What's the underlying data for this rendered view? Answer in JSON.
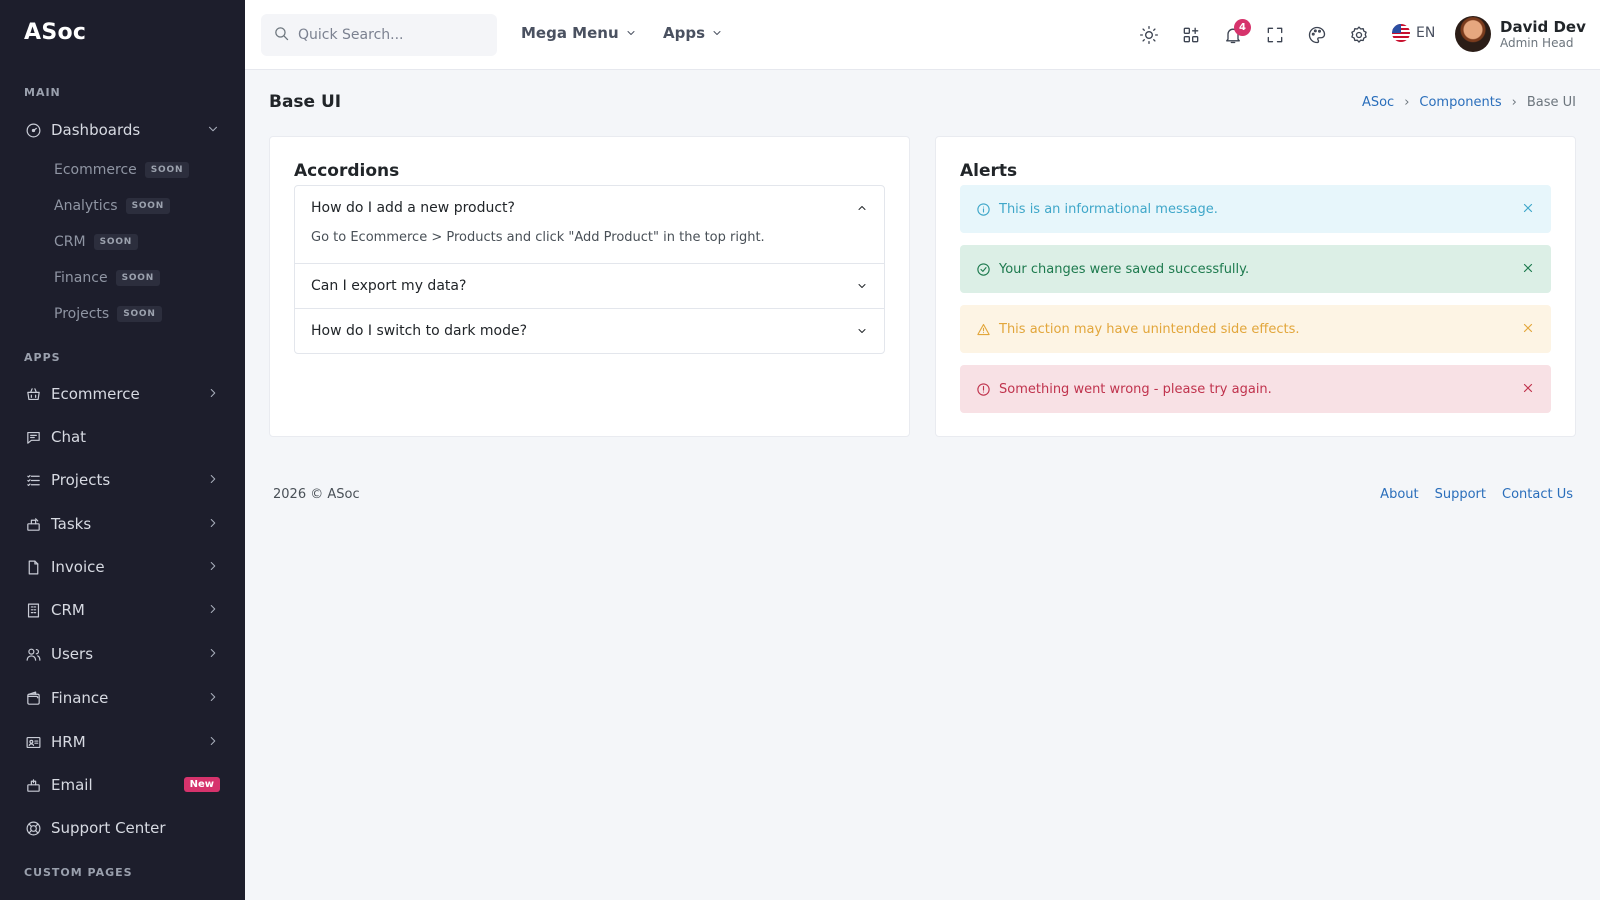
{
  "app": {
    "brand": "ASoc"
  },
  "sidebar": {
    "sections": {
      "main": "MAIN",
      "apps": "APPS",
      "custom": "CUSTOM PAGES"
    },
    "dashboards": {
      "label": "Dashboards",
      "soon": "SOON",
      "children": [
        "Ecommerce",
        "Analytics",
        "CRM",
        "Finance",
        "Projects"
      ]
    },
    "items": [
      {
        "label": "Ecommerce",
        "icon": "basket-icon"
      },
      {
        "label": "Chat",
        "icon": "chat-icon"
      },
      {
        "label": "Projects",
        "icon": "list-icon"
      },
      {
        "label": "Tasks",
        "icon": "tasks-icon"
      },
      {
        "label": "Invoice",
        "icon": "file-icon"
      },
      {
        "label": "CRM",
        "icon": "building-icon"
      },
      {
        "label": "Users",
        "icon": "users-icon"
      },
      {
        "label": "Finance",
        "icon": "wallet-icon"
      },
      {
        "label": "HRM",
        "icon": "id-card-icon"
      },
      {
        "label": "Email",
        "icon": "mailbox-icon",
        "badge": "New"
      },
      {
        "label": "Support Center",
        "icon": "lifebuoy-icon"
      }
    ]
  },
  "header": {
    "search_placeholder": "Quick Search...",
    "mega_menu": "Mega Menu",
    "apps": "Apps",
    "notifications_count": "4",
    "language": "EN",
    "user": {
      "name": "David Dev",
      "role": "Admin Head"
    }
  },
  "page": {
    "title": "Base UI",
    "breadcrumb": [
      "ASoc",
      "Components",
      "Base UI"
    ]
  },
  "accordions": {
    "title": "Accordions",
    "items": [
      {
        "question": "How do I add a new product?",
        "answer": "Go to Ecommerce > Products and click \"Add Product\" in the top right.",
        "expanded": true
      },
      {
        "question": "Can I export my data?",
        "expanded": false
      },
      {
        "question": "How do I switch to dark mode?",
        "expanded": false
      }
    ]
  },
  "alerts": {
    "title": "Alerts",
    "items": [
      {
        "type": "info",
        "text": "This is an informational message.",
        "color": "#3fa7c9"
      },
      {
        "type": "success",
        "text": "Your changes were saved successfully.",
        "color": "#1d7a4e"
      },
      {
        "type": "warning",
        "text": "This action may have unintended side effects.",
        "color": "#e2a63b"
      },
      {
        "type": "danger",
        "text": "Something went wrong - please try again.",
        "color": "#c0334d"
      }
    ]
  },
  "footer": {
    "copyright": "2026 © ASoc",
    "links": [
      "About",
      "Support",
      "Contact Us"
    ]
  },
  "colors": {
    "sidebar_bg": "#1d1e2c",
    "link": "#2a6ebb",
    "badge": "#d6336c"
  }
}
